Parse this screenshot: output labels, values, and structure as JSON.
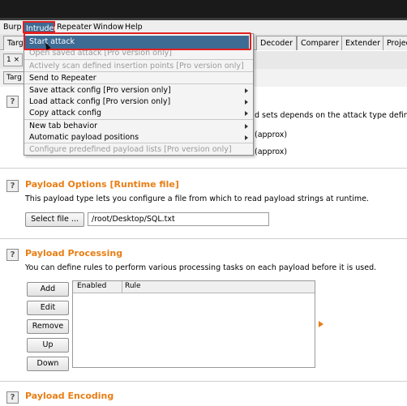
{
  "menubar": {
    "items": [
      "Burp",
      "Intruder",
      "Repeater",
      "Window",
      "Help"
    ]
  },
  "tabs": {
    "left_partial": "Targ",
    "right": [
      "Decoder",
      "Comparer",
      "Extender",
      "Projec"
    ]
  },
  "subtabs": {
    "number": "1",
    "close": "×",
    "target_partial": "Targ"
  },
  "dropdown": {
    "items": [
      {
        "label": "Start attack",
        "enabled": true,
        "submenu": false
      },
      {
        "label": "Open saved attack [Pro version only]",
        "enabled": false,
        "submenu": false
      },
      {
        "label": "Actively scan defined insertion points [Pro version only]",
        "enabled": false,
        "submenu": false
      },
      {
        "label": "Send to Repeater",
        "enabled": true,
        "submenu": false
      },
      {
        "label": "Save attack config [Pro version only]",
        "enabled": true,
        "submenu": true
      },
      {
        "label": "Load attack config [Pro version only]",
        "enabled": true,
        "submenu": true
      },
      {
        "label": "Copy attack config",
        "enabled": true,
        "submenu": true
      },
      {
        "label": "New tab behavior",
        "enabled": true,
        "submenu": true
      },
      {
        "label": "Automatic payload positions",
        "enabled": true,
        "submenu": true
      },
      {
        "label": "Configure predefined payload lists [Pro version only]",
        "enabled": false,
        "submenu": false
      }
    ]
  },
  "payload_sets": {
    "partial_text": "d sets depends on the attack type defined ir",
    "approx1": "(approx)",
    "approx2": "(approx)"
  },
  "payload_options": {
    "title": "Payload Options [Runtime file]",
    "description": "This payload type lets you configure a file from which to read payload strings at runtime.",
    "select_button": "Select file ...",
    "file_path": "/root/Desktop/SQL.txt"
  },
  "payload_processing": {
    "title": "Payload Processing",
    "description": "You can define rules to perform various processing tasks on each payload before it is used.",
    "buttons": [
      "Add",
      "Edit",
      "Remove",
      "Up",
      "Down"
    ],
    "columns": [
      "Enabled",
      "Rule"
    ]
  },
  "payload_encoding": {
    "title": "Payload Encoding"
  },
  "help_label": "?",
  "colors": {
    "accent": "#e87e15",
    "selection": "#3d6b94",
    "highlight": "#e02020"
  }
}
